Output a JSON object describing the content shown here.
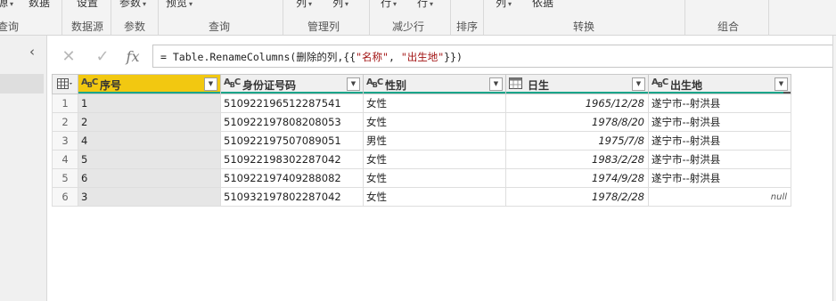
{
  "ribbon": {
    "top_items": [
      {
        "label": "源",
        "caret": true
      },
      {
        "label": "数据",
        "caret": false
      },
      {
        "label": "设置",
        "caret": false
      },
      {
        "label": "参数",
        "caret": true
      },
      {
        "label": "预览",
        "caret": true
      },
      {
        "label": "列",
        "caret": true
      },
      {
        "label": "列",
        "caret": true
      },
      {
        "label": "行",
        "caret": true
      },
      {
        "label": "行",
        "caret": true
      },
      {
        "label": "列",
        "caret": true
      },
      {
        "label": "依据",
        "caret": false
      }
    ],
    "groups": [
      "查询",
      "数据源",
      "参数",
      "查询",
      "管理列",
      "减少行",
      "排序",
      "转换",
      "组合"
    ]
  },
  "formula_bar": {
    "cancel_icon": "close-icon",
    "confirm_icon": "check-icon",
    "fx_label": "fx",
    "formula_prefix": "= Table.RenameColumns(删除的列,{{",
    "formula_old": "\"名称\"",
    "formula_sep": ", ",
    "formula_new": "\"出生地\"",
    "formula_suffix": "}})"
  },
  "grid": {
    "columns": [
      {
        "name": "序号",
        "type": "text",
        "type_label": "A",
        "type_sub": "B",
        "type_tail": "C"
      },
      {
        "name": "身份证号码",
        "type": "text",
        "type_label": "A",
        "type_sub": "B",
        "type_tail": "C"
      },
      {
        "name": "性别",
        "type": "text",
        "type_label": "A",
        "type_sub": "B",
        "type_tail": "C"
      },
      {
        "name": "日生",
        "type": "date",
        "type_label": "",
        "type_sub": "",
        "type_tail": ""
      },
      {
        "name": "出生地",
        "type": "text",
        "type_label": "A",
        "type_sub": "B",
        "type_tail": "C"
      }
    ],
    "rows": [
      {
        "n": "1",
        "c1": "1",
        "c2": "510922196512287541",
        "c3": "女性",
        "c4": "1965/12/28",
        "c5": "遂宁市--射洪县"
      },
      {
        "n": "2",
        "c1": "2",
        "c2": "510922197808208053",
        "c3": "女性",
        "c4": "1978/8/20",
        "c5": "遂宁市--射洪县"
      },
      {
        "n": "3",
        "c1": "4",
        "c2": "510922197507089051",
        "c3": "男性",
        "c4": "1975/7/8",
        "c5": "遂宁市--射洪县"
      },
      {
        "n": "4",
        "c1": "5",
        "c2": "510922198302287042",
        "c3": "女性",
        "c4": "1983/2/28",
        "c5": "遂宁市--射洪县"
      },
      {
        "n": "5",
        "c1": "6",
        "c2": "510922197409288082",
        "c3": "女性",
        "c4": "1974/9/28",
        "c5": "遂宁市--射洪县"
      },
      {
        "n": "6",
        "c1": "3",
        "c2": "510932197802287042",
        "c3": "女性",
        "c4": "1978/2/28",
        "c5": "null"
      }
    ]
  },
  "colors": {
    "selected_header": "#f2c811",
    "quality_bar": "#1aa58a"
  }
}
